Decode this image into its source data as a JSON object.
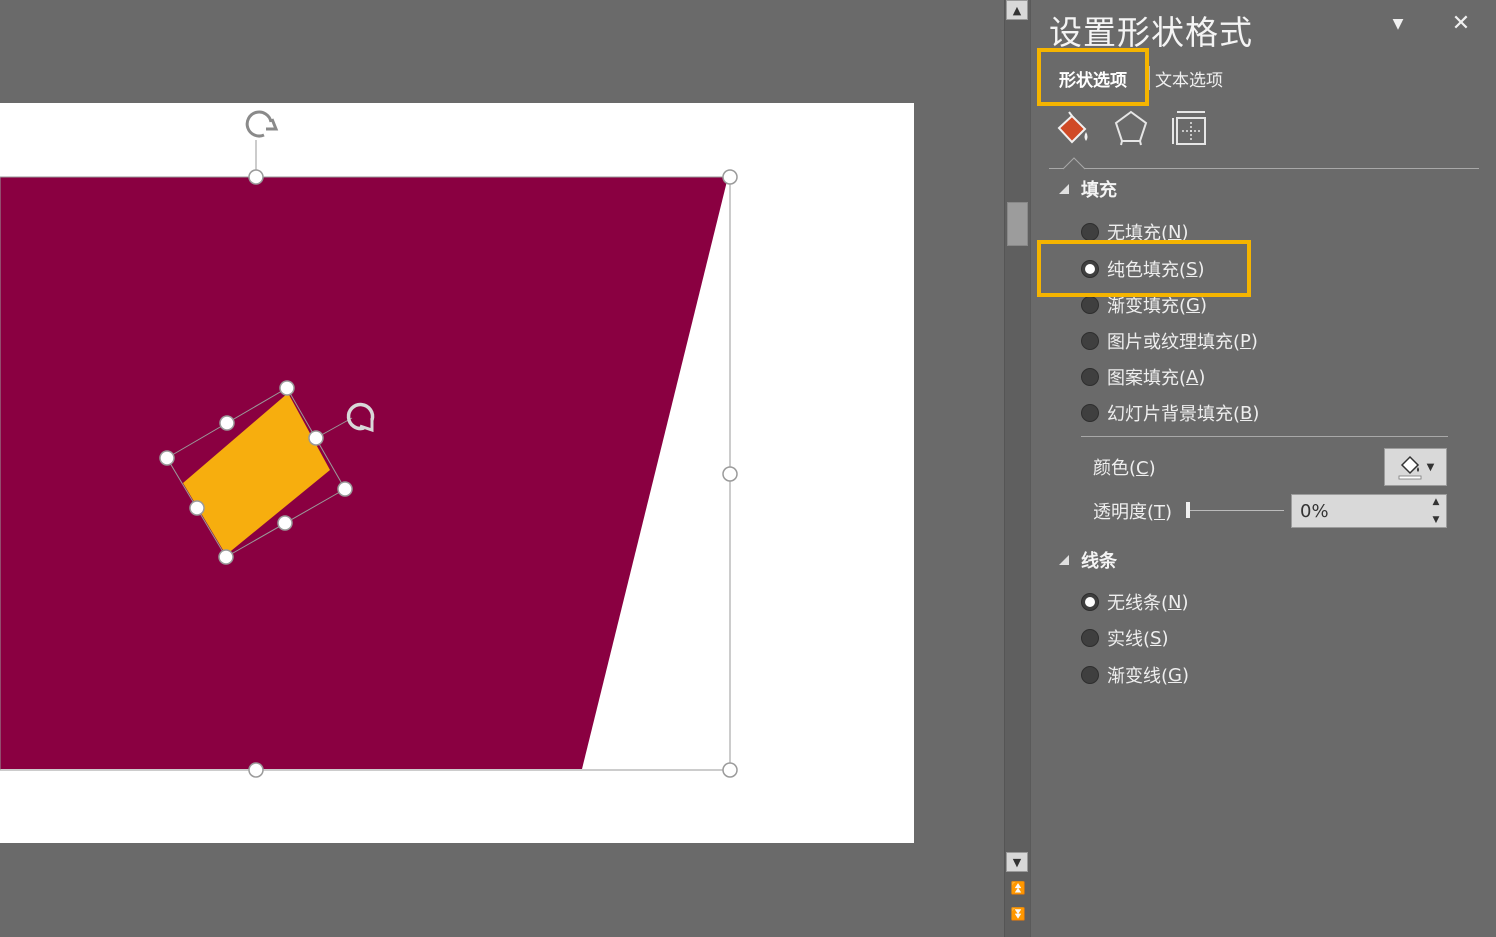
{
  "panel": {
    "title": "设置形状格式",
    "tabs": {
      "shape": "形状选项",
      "text": "文本选项"
    },
    "category_icons": [
      "fill-line-icon",
      "effects-pentagon-icon",
      "size-properties-icon"
    ],
    "fill": {
      "header": "填充",
      "options": [
        {
          "label": "无填充(",
          "key": "N",
          "tail": ")",
          "selected": false
        },
        {
          "label": "纯色填充(",
          "key": "S",
          "tail": ")",
          "selected": true
        },
        {
          "label": "渐变填充(",
          "key": "G",
          "tail": ")",
          "selected": false
        },
        {
          "label": "图片或纹理填充(",
          "key": "P",
          "tail": ")",
          "selected": false
        },
        {
          "label": "图案填充(",
          "key": "A",
          "tail": ")",
          "selected": false
        },
        {
          "label": "幻灯片背景填充(",
          "key": "B",
          "tail": ")",
          "selected": false
        }
      ],
      "color_label": "颜色(",
      "color_key": "C",
      "color_tail": ")",
      "transparency_label": "透明度(",
      "transparency_key": "T",
      "transparency_tail": ")",
      "transparency_value": "0%",
      "transparency_level": 0
    },
    "line": {
      "header": "线条",
      "options": [
        {
          "label": "无线条(",
          "key": "N",
          "tail": ")",
          "selected": true
        },
        {
          "label": "实线(",
          "key": "S",
          "tail": ")",
          "selected": false
        },
        {
          "label": "渐变线(",
          "key": "G",
          "tail": ")",
          "selected": false
        }
      ]
    }
  },
  "colors": {
    "background": "#6a6a6a",
    "slide": "#ffffff",
    "shape_fill": "#8a0041",
    "small_shape_fill": "#f7ae0e",
    "highlight": "#f5b400"
  }
}
